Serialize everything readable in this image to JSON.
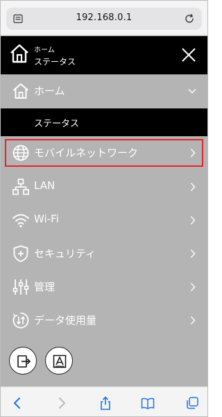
{
  "browser": {
    "url": "192.168.0.1",
    "icons": [
      "reader-icon",
      "reload-icon"
    ]
  },
  "header": {
    "line1": "ホーム",
    "line2": "ステータス",
    "icons": [
      "home-icon",
      "close-icon"
    ]
  },
  "menu": {
    "items": [
      {
        "label": "ホーム",
        "icon": "home-icon",
        "chevron": "chevron-down"
      },
      {
        "label": "モバイルネットワーク",
        "icon": "globe-icon",
        "chevron": "chevron-right"
      },
      {
        "label": "LAN",
        "icon": "network-icon",
        "chevron": "chevron-right"
      },
      {
        "label": "Wi-Fi",
        "icon": "wifi-icon",
        "chevron": "chevron-right"
      },
      {
        "label": "セキュリティ",
        "icon": "shield-icon",
        "chevron": "chevron-right"
      },
      {
        "label": "管理",
        "icon": "sliders-icon",
        "chevron": "chevron-right"
      },
      {
        "label": "データ使用量",
        "icon": "data-usage-icon",
        "chevron": "chevron-right"
      }
    ],
    "sub_item": {
      "label": "ステータス",
      "selected": true
    },
    "highlighted": "モバイルネットワーク"
  },
  "bottom_buttons": [
    "logout-icon",
    "text-size-icon"
  ],
  "toolbar": {
    "icons": [
      "back-icon",
      "forward-icon",
      "share-icon",
      "bookmarks-icon",
      "tabs-icon"
    ]
  },
  "colors": {
    "menu_bg": "#b4b4b4",
    "header_bg": "#000000",
    "highlight_border": "#e8232b",
    "toolbar_blue": "#1a73e8"
  }
}
